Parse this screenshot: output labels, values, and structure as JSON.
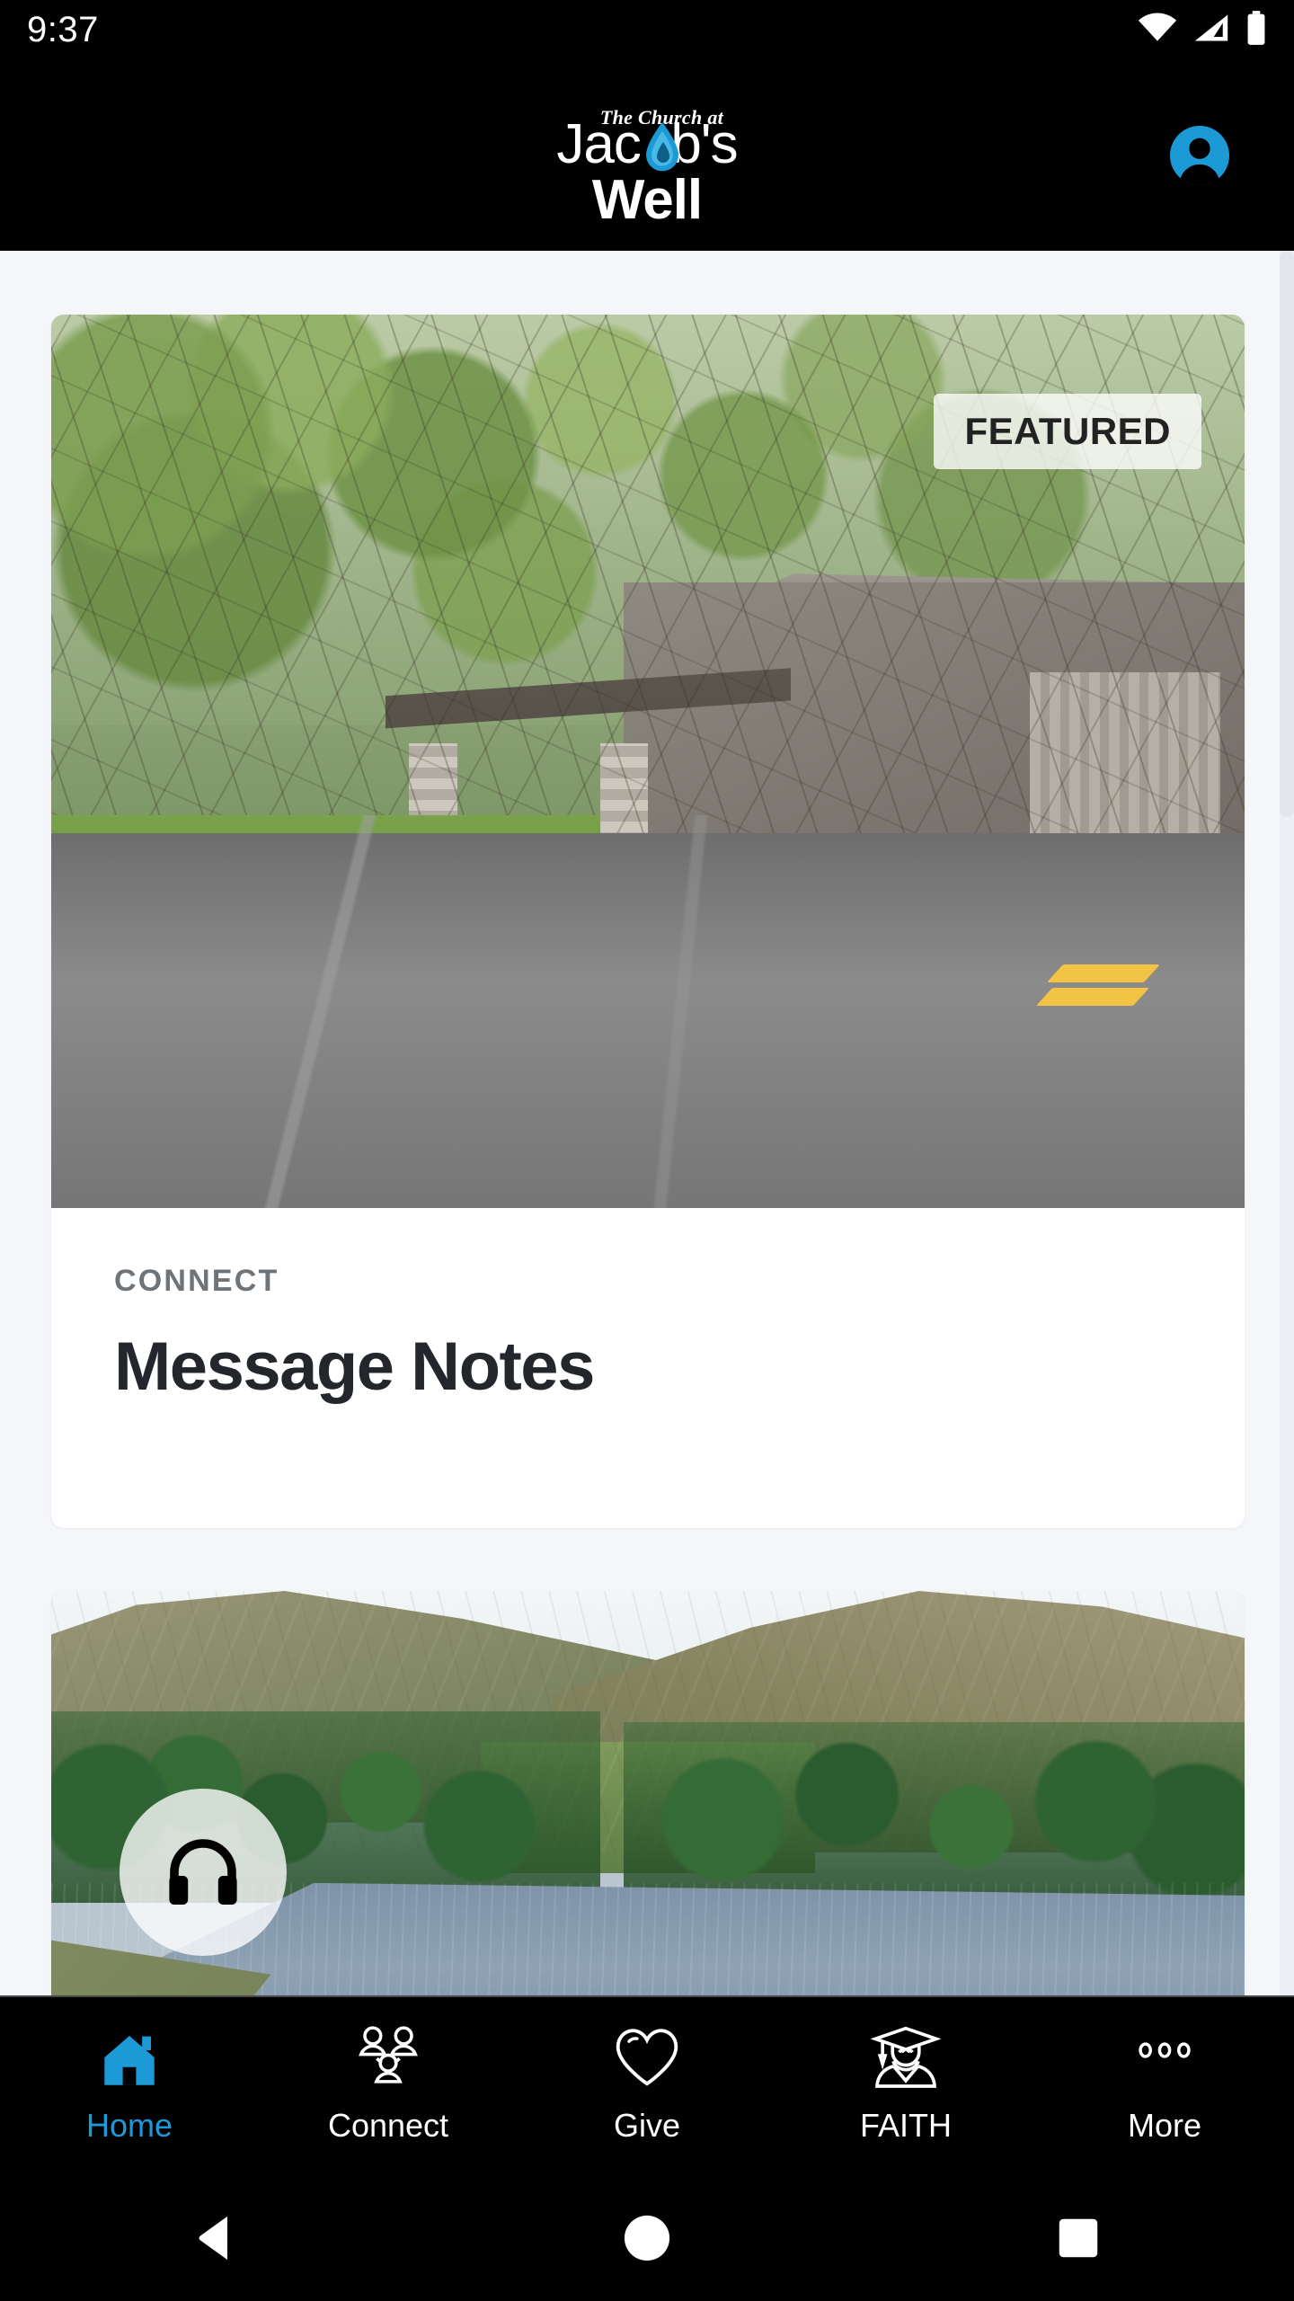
{
  "status_bar": {
    "clock": "9:37",
    "icons": [
      "wifi-icon",
      "cellular-signal-icon",
      "battery-icon"
    ]
  },
  "header": {
    "brand_tagline": "The Church at",
    "brand_line1": "Jac",
    "brand_line1_tail": "b's",
    "brand_line2": "Well",
    "drop_icon": "water-drop-icon",
    "drop_color": "#1c9ad6",
    "profile_icon": "account-avatar-icon",
    "profile_color": "#1c9ad6",
    "background": "#000000"
  },
  "feed": {
    "background": "#f4f6f9",
    "cards": [
      {
        "badge": "FEATURED",
        "eyebrow": "CONNECT",
        "title": "Message Notes",
        "image_alt": "church-building-driveway-photo",
        "eyebrow_color": "#6f7478",
        "title_color": "#23262a"
      },
      {
        "image_alt": "mountain-valley-lake-photo",
        "overlay_button_icon": "headphones-icon"
      }
    ]
  },
  "tab_bar": {
    "active_index": 0,
    "active_color": "#1c9ad6",
    "items": [
      {
        "label": "Home",
        "icon": "home-icon"
      },
      {
        "label": "Connect",
        "icon": "people-group-icon"
      },
      {
        "label": "Give",
        "icon": "heart-icon"
      },
      {
        "label": "FAITH",
        "icon": "graduate-icon"
      },
      {
        "label": "More",
        "icon": "ellipsis-icon"
      }
    ]
  },
  "system_nav": {
    "back": "back-triangle-icon",
    "home": "home-circle-icon",
    "recents": "recents-square-icon"
  }
}
